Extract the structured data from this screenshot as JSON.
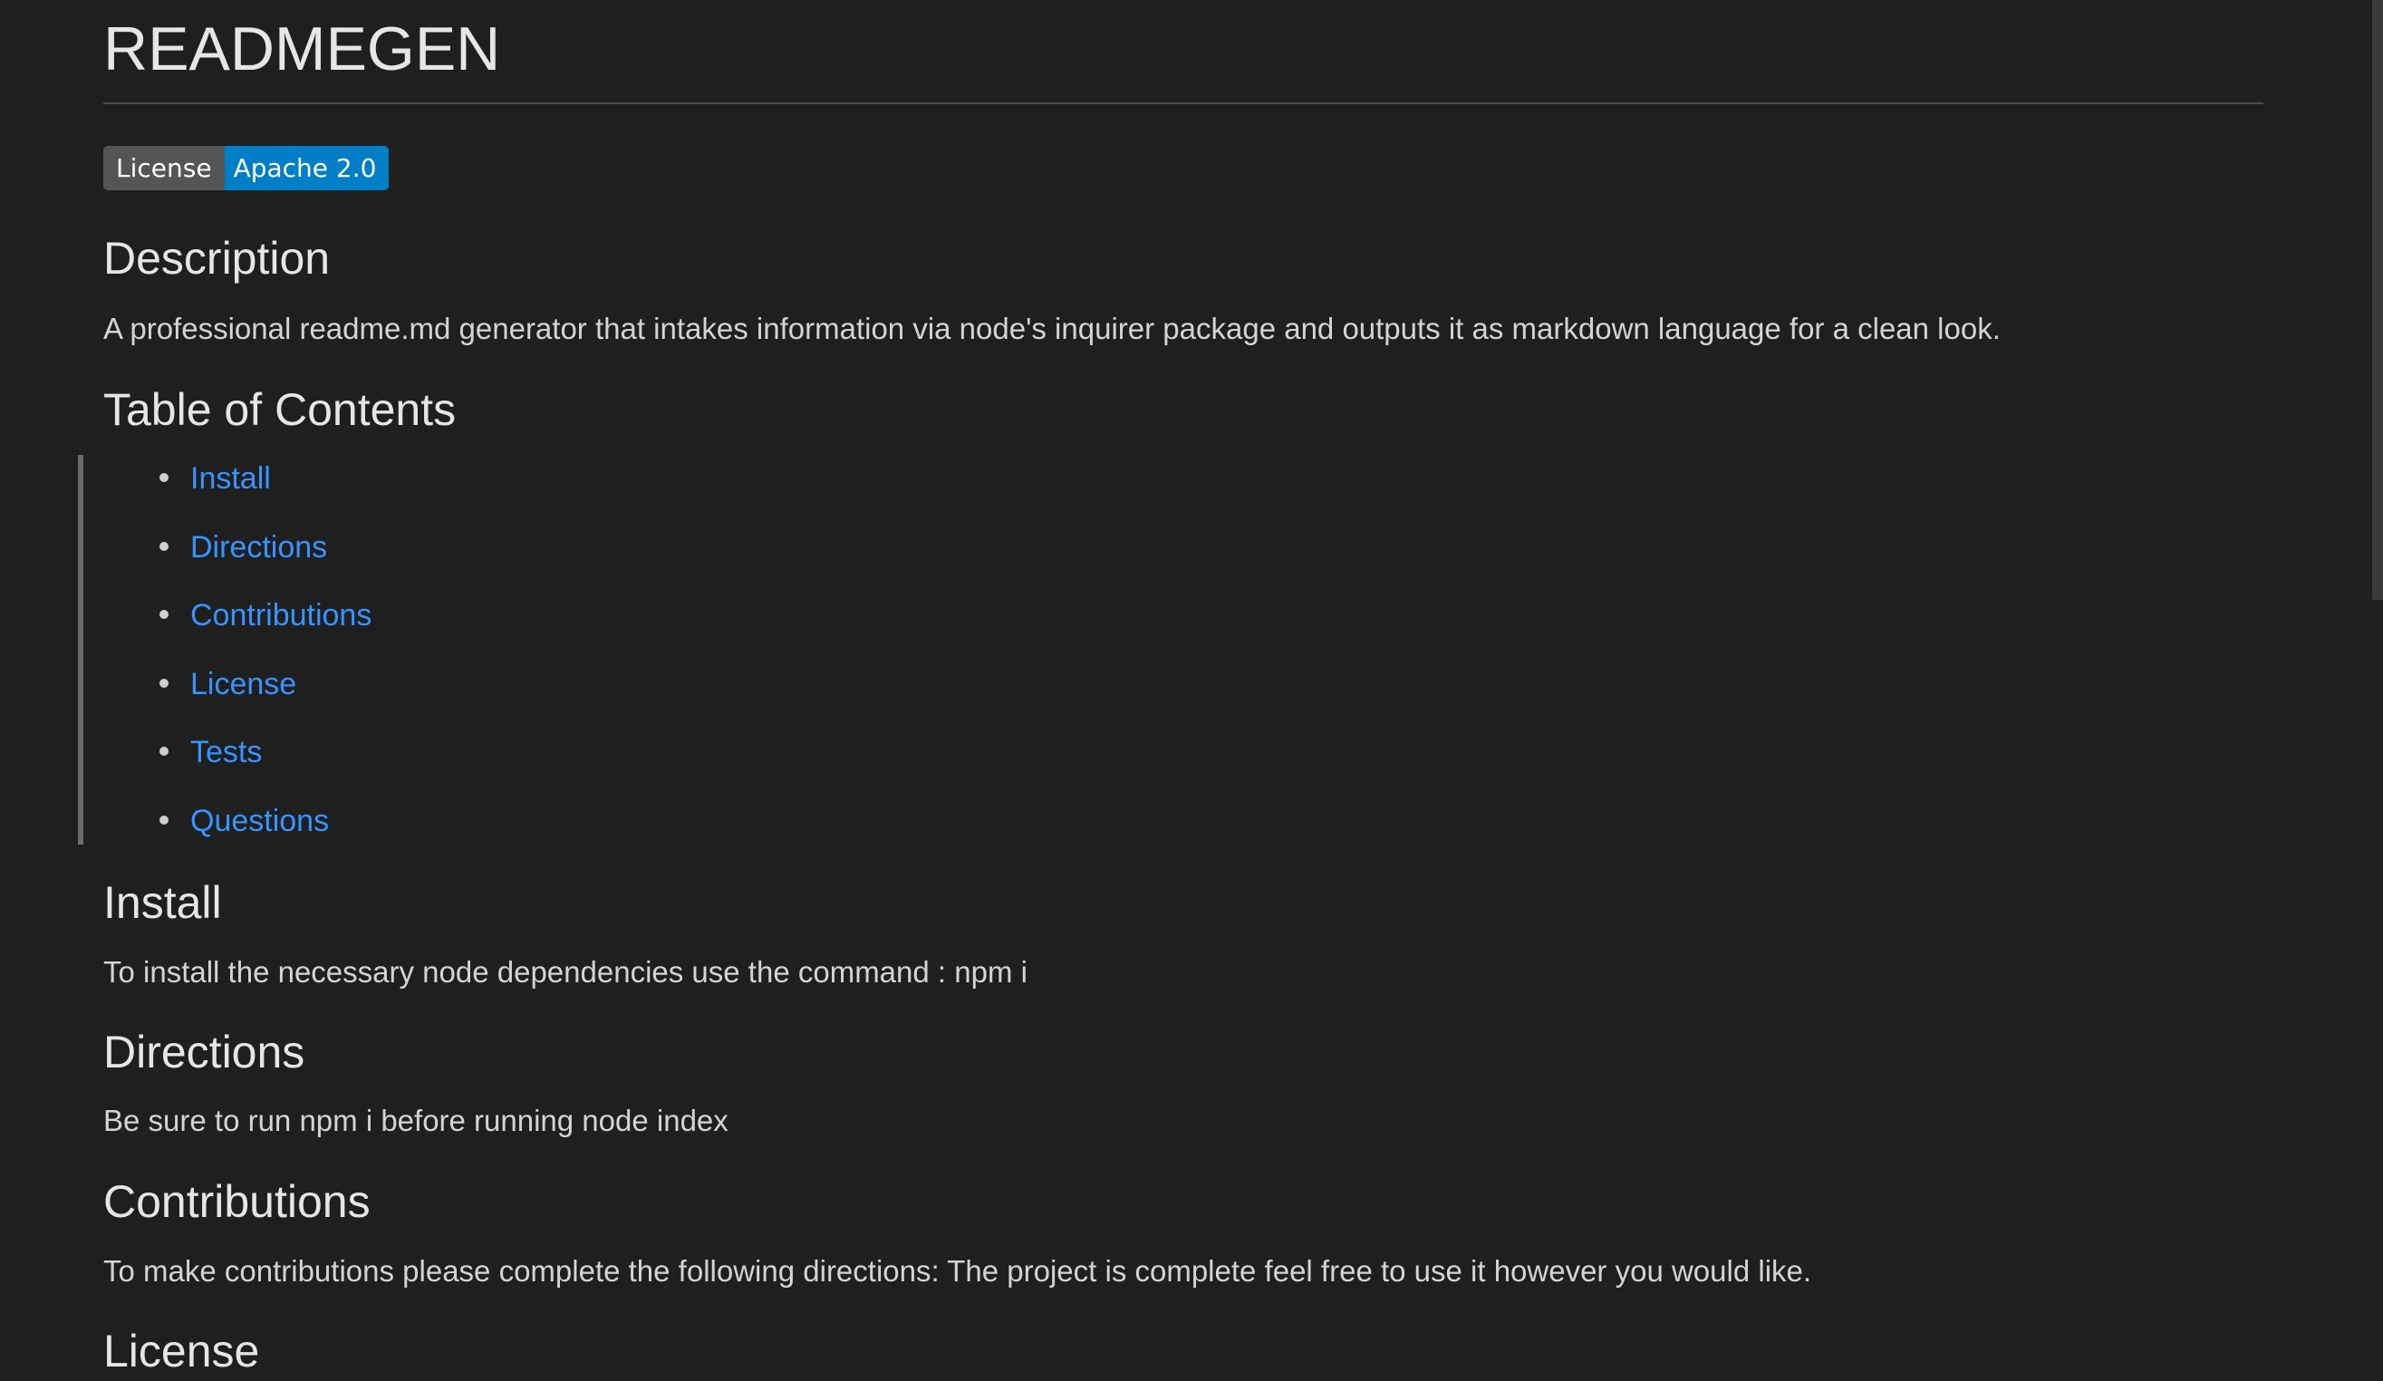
{
  "title": "READMEGEN",
  "badge": {
    "left": "License",
    "right": "Apache 2.0"
  },
  "sections": {
    "description": {
      "heading": "Description",
      "text": "A professional readme.md generator that intakes information via node's inquirer package and outputs it as markdown language for a clean look."
    },
    "toc": {
      "heading": "Table of Contents",
      "items": [
        "Install",
        "Directions",
        "Contributions",
        "License",
        "Tests",
        "Questions"
      ]
    },
    "install": {
      "heading": "Install",
      "text": "To install the necessary node dependencies use the command : npm i"
    },
    "directions": {
      "heading": "Directions",
      "text": "Be sure to run npm i before running node index"
    },
    "contributions": {
      "heading": "Contributions",
      "text": "To make contributions please complete the following directions: The project is complete feel free to use it however you would like."
    },
    "license": {
      "heading": "License"
    }
  },
  "colors": {
    "background": "#1f1f1f",
    "link": "#3794ff",
    "badge_left": "#555555",
    "badge_right": "#007ec6"
  }
}
